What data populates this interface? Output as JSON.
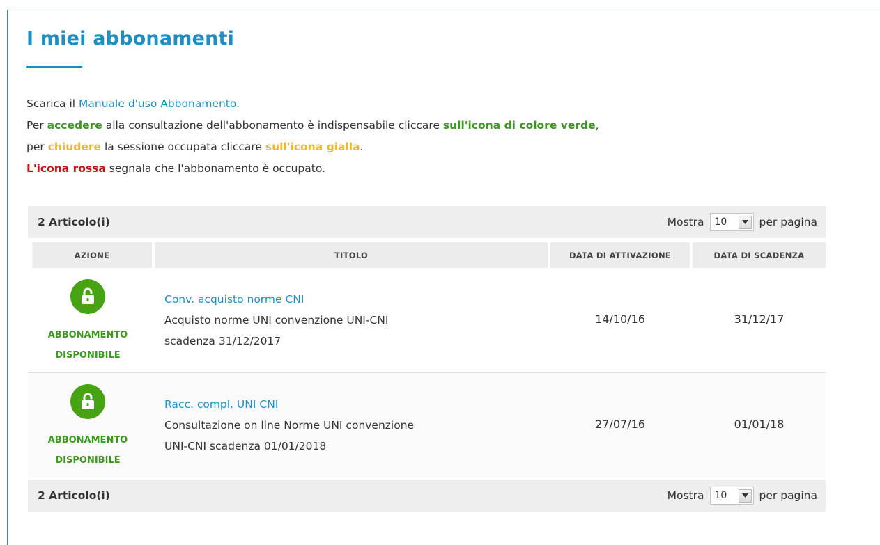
{
  "page": {
    "title": "I miei abbonamenti"
  },
  "intro": {
    "line1_prefix": "Scarica il ",
    "manual_link": "Manuale d'uso Abbonamento",
    "line1_suffix": ".",
    "line2_a": "Per ",
    "line2_accedere": "accedere",
    "line2_b": " alla consultazione dell'abbonamento è indispensabile cliccare ",
    "line2_green_icon": "sull'icona di colore verde",
    "line2_c": ",",
    "line3_a": "per ",
    "line3_chiudere": "chiudere",
    "line3_b": " la sessione occupata cliccare ",
    "line3_yellow_icon": "sull'icona gialla",
    "line3_c": ".",
    "line4_red_icon": "L'icona rossa",
    "line4_b": " segnala che l'abbonamento è occupato."
  },
  "pager": {
    "count_label": "2 Articolo(i)",
    "show_label": "Mostra",
    "per_page_value": "10",
    "per_page_suffix": "per pagina"
  },
  "table": {
    "headers": [
      "AZIONE",
      "TITOLO",
      "DATA DI ATTIVAZIONE",
      "DATA DI SCADENZA"
    ],
    "rows": [
      {
        "status_line1": "ABBONAMENTO",
        "status_line2": "DISPONIBILE",
        "title": "Conv. acquisto norme CNI",
        "desc_line1": "Acquisto norme UNI convenzione UNI-CNI",
        "desc_line2": "scadenza 31/12/2017",
        "activation": "14/10/16",
        "expiry": "31/12/17",
        "icon": "unlock-icon"
      },
      {
        "status_line1": "ABBONAMENTO",
        "status_line2": "DISPONIBILE",
        "title": "Racc. compl. UNI CNI",
        "desc_line1": "Consultazione on line Norme UNI convenzione",
        "desc_line2": "UNI-CNI scadenza 01/01/2018",
        "activation": "27/07/16",
        "expiry": "01/01/18",
        "icon": "unlock-icon"
      }
    ]
  },
  "colors": {
    "accent": "#1f8ec5",
    "green": "#3a9a1e",
    "yellow": "#f2b824",
    "red": "#c0161a",
    "badge_green": "#47a312"
  }
}
